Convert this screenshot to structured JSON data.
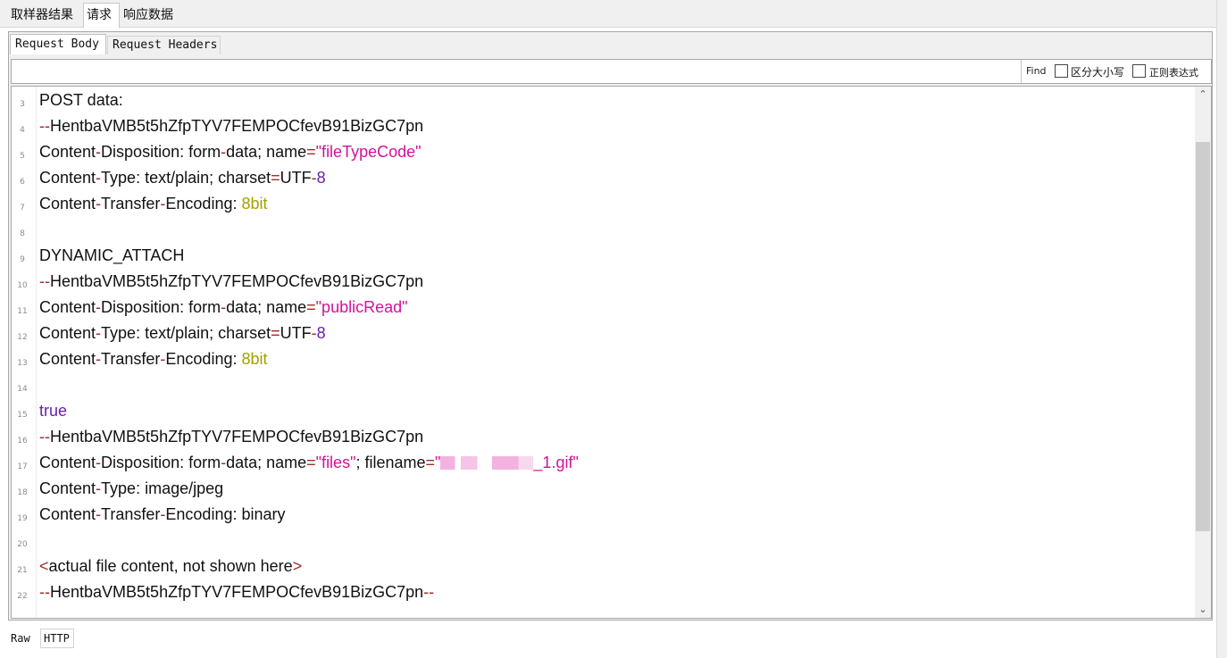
{
  "top_tabs": [
    "取样器结果",
    "请求",
    "响应数据"
  ],
  "sub_tabs": [
    "Request Body",
    "Request Headers"
  ],
  "find": {
    "value": "",
    "label": "Find",
    "case_sensitive": "区分大小写",
    "regex": "正则表达式"
  },
  "code_lines": [
    {
      "n": "3",
      "t": [
        "POST data:"
      ]
    },
    {
      "n": "4",
      "t": [
        "--",
        "HentbaVMB5t5hZfpTYV7FEMPOCfevB91BizGC7pn"
      ]
    },
    {
      "n": "5",
      "t": [
        "Content",
        "-",
        "Disposition: form",
        "-",
        "data; name",
        "=",
        "\"fileTypeCode\""
      ]
    },
    {
      "n": "6",
      "t": [
        "Content",
        "-",
        "Type: text/plain; charset",
        "=",
        "UTF",
        "-",
        "8"
      ]
    },
    {
      "n": "7",
      "t": [
        "Content",
        "-",
        "Transfer",
        "-",
        "Encoding: ",
        "8bit"
      ]
    },
    {
      "n": "8",
      "t": [
        ""
      ]
    },
    {
      "n": "9",
      "t": [
        "DYNAMIC_ATTACH"
      ]
    },
    {
      "n": "10",
      "t": [
        "--",
        "HentbaVMB5t5hZfpTYV7FEMPOCfevB91BizGC7pn"
      ]
    },
    {
      "n": "11",
      "t": [
        "Content",
        "-",
        "Disposition: form",
        "-",
        "data; name",
        "=",
        "\"publicRead\""
      ]
    },
    {
      "n": "12",
      "t": [
        "Content",
        "-",
        "Type: text/plain; charset",
        "=",
        "UTF",
        "-",
        "8"
      ]
    },
    {
      "n": "13",
      "t": [
        "Content",
        "-",
        "Transfer",
        "-",
        "Encoding: ",
        "8bit"
      ]
    },
    {
      "n": "14",
      "t": [
        ""
      ]
    },
    {
      "n": "15",
      "t": [
        "true"
      ]
    },
    {
      "n": "16",
      "t": [
        "--",
        "HentbaVMB5t5hZfpTYV7FEMPOCfevB91BizGC7pn"
      ]
    },
    {
      "n": "17",
      "t": [
        "Content",
        "-",
        "Disposition: form",
        "-",
        "data; name",
        "=",
        "\"files\"",
        "; filename",
        "=",
        "\"",
        "_1.gif\""
      ]
    },
    {
      "n": "18",
      "t": [
        "Content",
        "-",
        "Type: image/jpeg"
      ]
    },
    {
      "n": "19",
      "t": [
        "Content",
        "-",
        "Transfer",
        "-",
        "Encoding: binary"
      ]
    },
    {
      "n": "20",
      "t": [
        ""
      ]
    },
    {
      "n": "21",
      "t": [
        "<",
        "actual file content, not shown here",
        ">"
      ]
    },
    {
      "n": "22",
      "t": [
        "--",
        "HentbaVMB5t5hZfpTYV7FEMPOCfevB91BizGC7pn",
        "--"
      ]
    }
  ],
  "bottom_tabs": [
    "Raw",
    "HTTP"
  ],
  "colors": {
    "operator": "#a02b2b",
    "string": "#d4109a",
    "number": "#6a1fb0",
    "keyword": "#a3a000"
  }
}
